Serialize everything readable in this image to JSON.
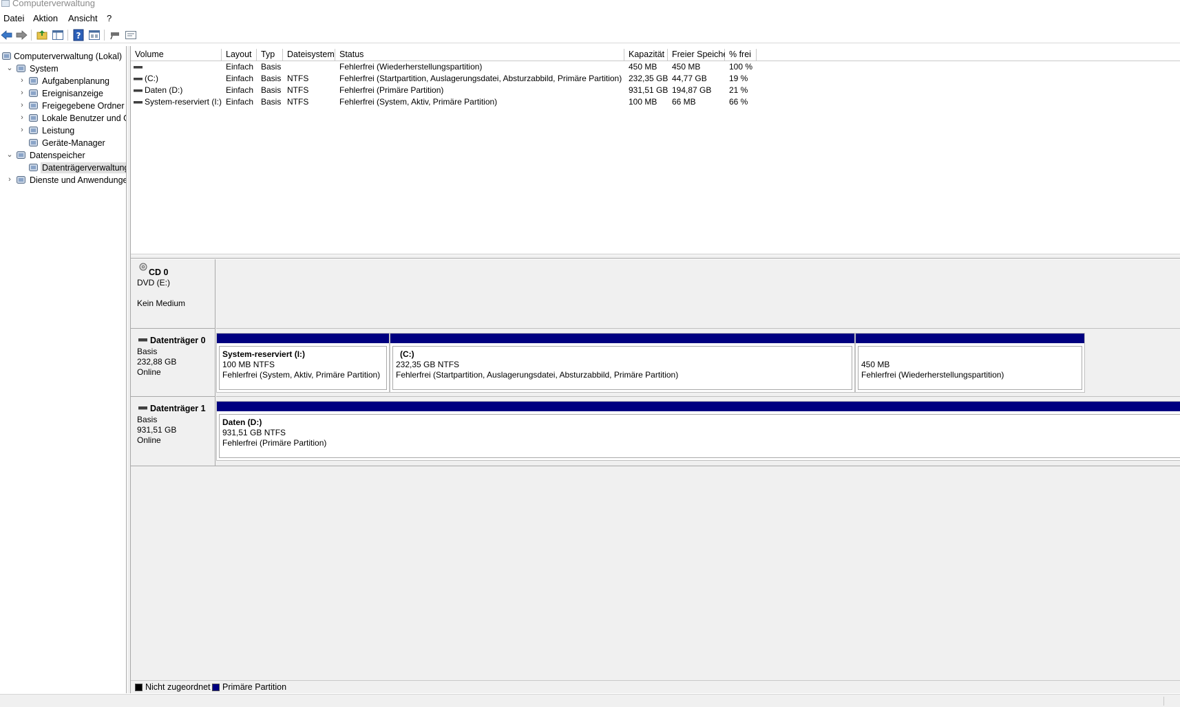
{
  "window": {
    "title": "Computerverwaltung"
  },
  "menu": {
    "items": [
      "Datei",
      "Aktion",
      "Ansicht",
      "?"
    ]
  },
  "toolbar": {
    "buttons": [
      "back-icon",
      "forward-icon",
      "up-folder-icon",
      "show-hide-tree-icon",
      "help-icon",
      "properties-icon",
      "connect-icon",
      "settings-icon"
    ]
  },
  "tree": {
    "nodes": [
      {
        "label": "Computerverwaltung (Lokal)",
        "icon": "computer-management-icon",
        "level": 0,
        "expander": ""
      },
      {
        "label": "System",
        "icon": "system-tools-icon",
        "level": 1,
        "expander": "expanded"
      },
      {
        "label": "Aufgabenplanung",
        "icon": "task-scheduler-icon",
        "level": 2,
        "expander": "collapsed"
      },
      {
        "label": "Ereignisanzeige",
        "icon": "event-viewer-icon",
        "level": 2,
        "expander": "collapsed"
      },
      {
        "label": "Freigegebene Ordner",
        "icon": "shared-folders-icon",
        "level": 2,
        "expander": "collapsed"
      },
      {
        "label": "Lokale Benutzer und Gr",
        "icon": "local-users-icon",
        "level": 2,
        "expander": "collapsed"
      },
      {
        "label": "Leistung",
        "icon": "performance-icon",
        "level": 2,
        "expander": "collapsed"
      },
      {
        "label": "Geräte-Manager",
        "icon": "device-manager-icon",
        "level": 2,
        "expander": ""
      },
      {
        "label": "Datenspeicher",
        "icon": "storage-icon",
        "level": 1,
        "expander": "expanded"
      },
      {
        "label": "Datenträgerverwaltung",
        "icon": "disk-management-icon",
        "level": 2,
        "expander": "",
        "selected": true
      },
      {
        "label": "Dienste und Anwendungen",
        "icon": "services-icon",
        "level": 1,
        "expander": "collapsed"
      }
    ]
  },
  "volumes": {
    "columns": [
      "Volume",
      "Layout",
      "Typ",
      "Dateisystem",
      "Status",
      "Kapazität",
      "Freier Speicher",
      "% frei"
    ],
    "rows": [
      [
        "",
        "Einfach",
        "Basis",
        "",
        "Fehlerfrei (Wiederherstellungspartition)",
        "450 MB",
        "450 MB",
        "100 %"
      ],
      [
        "(C:)",
        "Einfach",
        "Basis",
        "NTFS",
        "Fehlerfrei (Startpartition, Auslagerungsdatei, Absturzabbild, Primäre Partition)",
        "232,35 GB",
        "44,77 GB",
        "19 %"
      ],
      [
        "Daten (D:)",
        "Einfach",
        "Basis",
        "NTFS",
        "Fehlerfrei (Primäre Partition)",
        "931,51 GB",
        "194,87 GB",
        "21 %"
      ],
      [
        "System-reserviert (I:)",
        "Einfach",
        "Basis",
        "NTFS",
        "Fehlerfrei (System, Aktiv, Primäre Partition)",
        "100 MB",
        "66 MB",
        "66 %"
      ]
    ]
  },
  "disks": {
    "cd0": {
      "name": "CD 0",
      "line1": "DVD (E:)",
      "line2": "Kein Medium"
    },
    "disk0": {
      "name": "Datenträger 0",
      "type": "Basis",
      "size": "232,88 GB",
      "state": "Online",
      "partitions": [
        {
          "title": "System-reserviert  (I:)",
          "size": "100 MB NTFS",
          "status": "Fehlerfrei (System, Aktiv, Primäre Partition)"
        },
        {
          "title": "(C:)",
          "size": "232,35 GB NTFS",
          "status": "Fehlerfrei (Startpartition, Auslagerungsdatei, Absturzabbild, Primäre Partition)"
        },
        {
          "title": "",
          "size": "450 MB",
          "status": "Fehlerfrei (Wiederherstellungspartition)"
        }
      ]
    },
    "disk1": {
      "name": "Datenträger 1",
      "type": "Basis",
      "size": "931,51 GB",
      "state": "Online",
      "partitions": [
        {
          "title": "Daten  (D:)",
          "size": "931,51 GB NTFS",
          "status": "Fehlerfrei (Primäre Partition)"
        }
      ]
    }
  },
  "legend": {
    "items": [
      {
        "label": "Nicht zugeordnet",
        "color": "#000000"
      },
      {
        "label": "Primäre Partition",
        "color": "#000080"
      }
    ]
  },
  "colors": {
    "primary_partition": "#000080",
    "unallocated": "#000000",
    "pane_bg": "#f0f0f0"
  }
}
